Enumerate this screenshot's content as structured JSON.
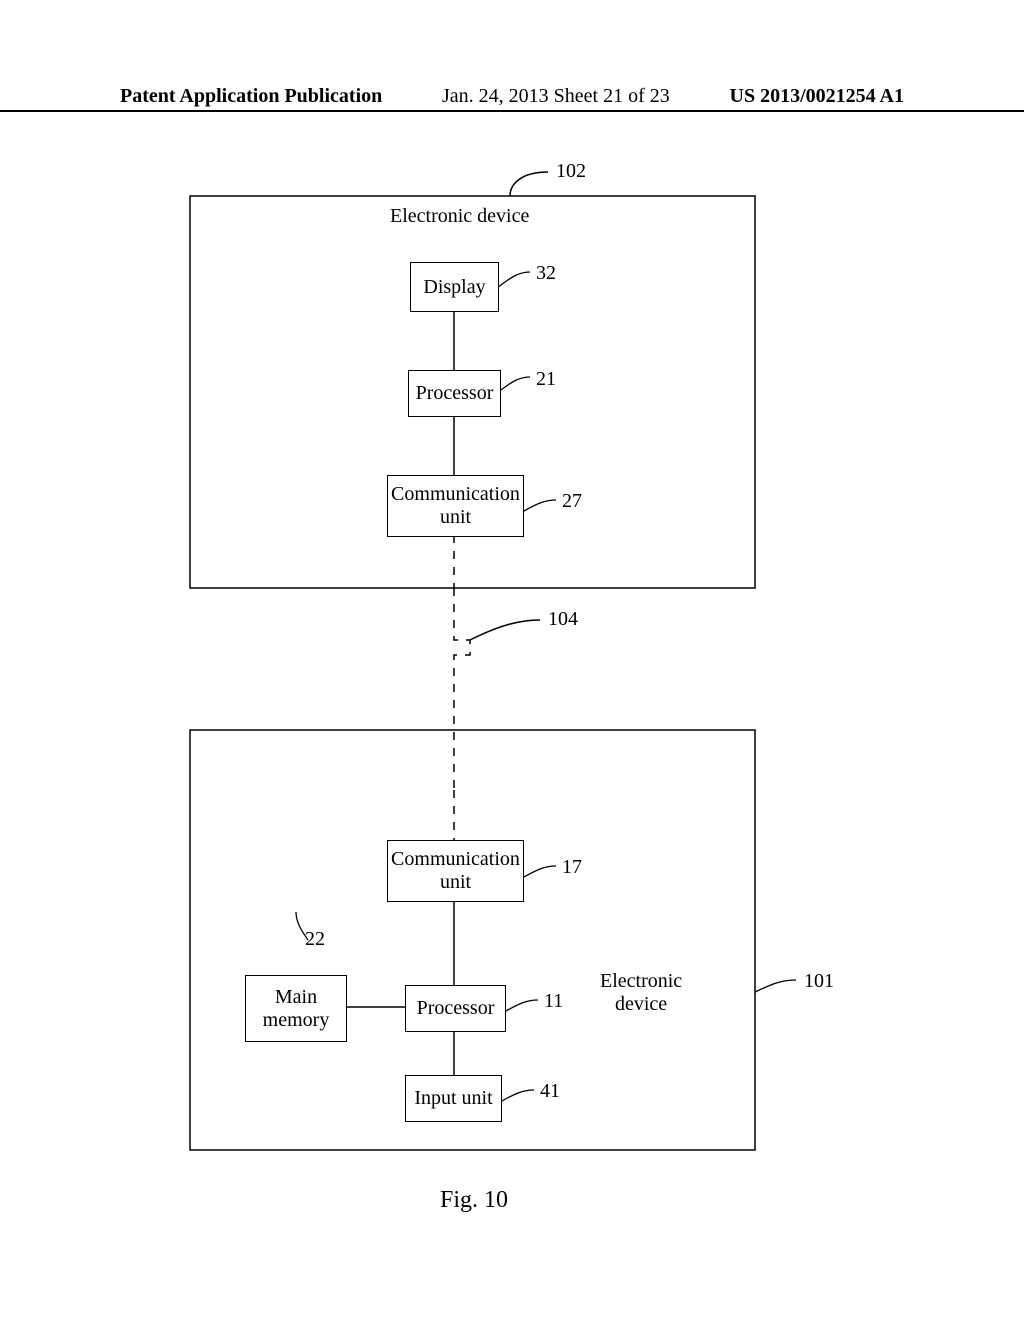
{
  "header": {
    "left": "Patent Application Publication",
    "center": "Jan. 24, 2013   Sheet 21 of 23",
    "right": "US 2013/0021254 A1"
  },
  "diagram": {
    "device102": {
      "title": "Electronic device",
      "ref": "102",
      "blocks": {
        "display": {
          "label": "Display",
          "ref": "32"
        },
        "processor": {
          "label": "Processor",
          "ref": "21"
        },
        "comm": {
          "label1": "Communication",
          "label2": "unit",
          "ref": "27"
        }
      }
    },
    "link": {
      "ref": "104"
    },
    "device101": {
      "title": "Electronic\ndevice",
      "title1": "Electronic",
      "title2": "device",
      "ref": "101",
      "blocks": {
        "comm": {
          "label1": "Communication",
          "label2": "unit",
          "ref": "17"
        },
        "mainmem": {
          "label1": "Main",
          "label2": "memory",
          "ref": "22"
        },
        "processor": {
          "label": "Processor",
          "ref": "11"
        },
        "input": {
          "label": "Input unit",
          "ref": "41"
        }
      }
    }
  },
  "figure": "Fig. 10"
}
